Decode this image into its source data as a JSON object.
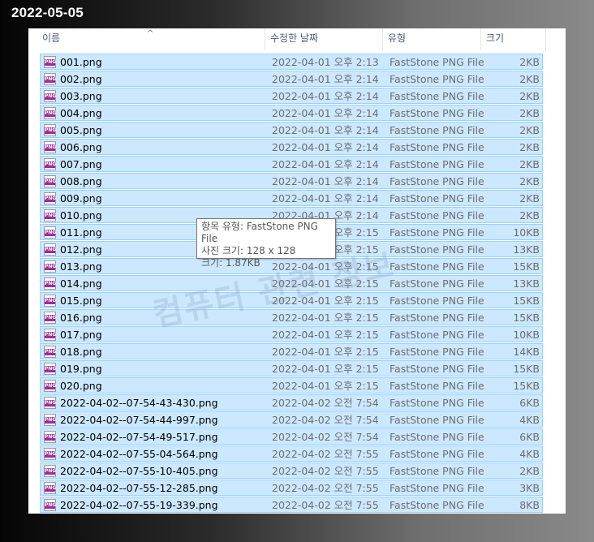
{
  "page_title": "2022-05-05",
  "columns": {
    "name": "이름",
    "date": "수정한 날짜",
    "type": "유형",
    "size": "크기"
  },
  "files": [
    {
      "name": "001.png",
      "date": "2022-04-01 오후 2:13",
      "type": "FastStone PNG File",
      "size": "2KB"
    },
    {
      "name": "002.png",
      "date": "2022-04-01 오후 2:14",
      "type": "FastStone PNG File",
      "size": "2KB"
    },
    {
      "name": "003.png",
      "date": "2022-04-01 오후 2:14",
      "type": "FastStone PNG File",
      "size": "2KB"
    },
    {
      "name": "004.png",
      "date": "2022-04-01 오후 2:14",
      "type": "FastStone PNG File",
      "size": "2KB"
    },
    {
      "name": "005.png",
      "date": "2022-04-01 오후 2:14",
      "type": "FastStone PNG File",
      "size": "2KB"
    },
    {
      "name": "006.png",
      "date": "2022-04-01 오후 2:14",
      "type": "FastStone PNG File",
      "size": "2KB"
    },
    {
      "name": "007.png",
      "date": "2022-04-01 오후 2:14",
      "type": "FastStone PNG File",
      "size": "2KB"
    },
    {
      "name": "008.png",
      "date": "2022-04-01 오후 2:14",
      "type": "FastStone PNG File",
      "size": "2KB"
    },
    {
      "name": "009.png",
      "date": "2022-04-01 오후 2:14",
      "type": "FastStone PNG File",
      "size": "2KB"
    },
    {
      "name": "010.png",
      "date": "2022-04-01 오후 2:14",
      "type": "FastStone PNG File",
      "size": "2KB"
    },
    {
      "name": "011.png",
      "date": "2022-04-01 오후 2:15",
      "type": "FastStone PNG File",
      "size": "10KB"
    },
    {
      "name": "012.png",
      "date": "2022-04-01 오후 2:15",
      "type": "FastStone PNG File",
      "size": "13KB"
    },
    {
      "name": "013.png",
      "date": "2022-04-01 오후 2:15",
      "type": "FastStone PNG File",
      "size": "15KB"
    },
    {
      "name": "014.png",
      "date": "2022-04-01 오후 2:15",
      "type": "FastStone PNG File",
      "size": "13KB"
    },
    {
      "name": "015.png",
      "date": "2022-04-01 오후 2:15",
      "type": "FastStone PNG File",
      "size": "15KB"
    },
    {
      "name": "016.png",
      "date": "2022-04-01 오후 2:15",
      "type": "FastStone PNG File",
      "size": "15KB"
    },
    {
      "name": "017.png",
      "date": "2022-04-01 오후 2:15",
      "type": "FastStone PNG File",
      "size": "10KB"
    },
    {
      "name": "018.png",
      "date": "2022-04-01 오후 2:15",
      "type": "FastStone PNG File",
      "size": "14KB"
    },
    {
      "name": "019.png",
      "date": "2022-04-01 오후 2:15",
      "type": "FastStone PNG File",
      "size": "15KB"
    },
    {
      "name": "020.png",
      "date": "2022-04-01 오후 2:15",
      "type": "FastStone PNG File",
      "size": "15KB"
    },
    {
      "name": "2022-04-02--07-54-43-430.png",
      "date": "2022-04-02 오전 7:54",
      "type": "FastStone PNG File",
      "size": "6KB"
    },
    {
      "name": "2022-04-02--07-54-44-997.png",
      "date": "2022-04-02 오전 7:54",
      "type": "FastStone PNG File",
      "size": "4KB"
    },
    {
      "name": "2022-04-02--07-54-49-517.png",
      "date": "2022-04-02 오전 7:54",
      "type": "FastStone PNG File",
      "size": "6KB"
    },
    {
      "name": "2022-04-02--07-55-04-564.png",
      "date": "2022-04-02 오전 7:55",
      "type": "FastStone PNG File",
      "size": "4KB"
    },
    {
      "name": "2022-04-02--07-55-10-405.png",
      "date": "2022-04-02 오전 7:55",
      "type": "FastStone PNG File",
      "size": "2KB"
    },
    {
      "name": "2022-04-02--07-55-12-285.png",
      "date": "2022-04-02 오전 7:55",
      "type": "FastStone PNG File",
      "size": "3KB"
    },
    {
      "name": "2022-04-02--07-55-19-339.png",
      "date": "2022-04-02 오전 7:55",
      "type": "FastStone PNG File",
      "size": "8KB"
    }
  ],
  "tooltip": {
    "line1": "항목 유형: FastStone PNG File",
    "line2": "사진 크기: 128 x 128",
    "line3": "크기: 1.87KB"
  },
  "watermark": "컴퓨터 관련 정보",
  "icon": {
    "name": "png-file-icon",
    "label": "PNG",
    "color": "#a02a9c"
  },
  "colors": {
    "selection_bg": "#cce8ff",
    "selection_border": "#99d1ff"
  }
}
